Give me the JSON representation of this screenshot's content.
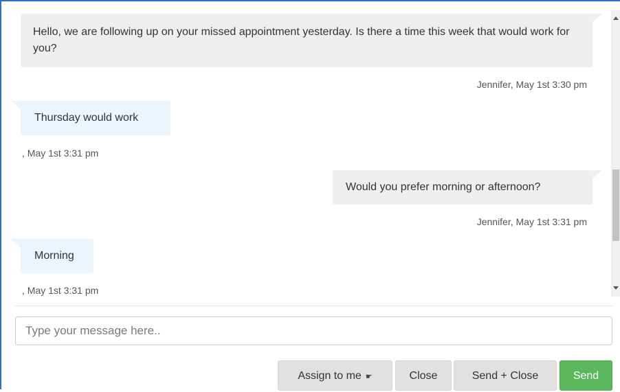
{
  "chat": {
    "messages": [
      {
        "sender": "agent",
        "text": "Hello, we are following up on your missed appointment yesterday. Is there a time this week that would work for you?",
        "meta": "Jennifer, May 1st 3:30 pm"
      },
      {
        "sender": "customer",
        "text": "Thursday would work",
        "meta": ", May 1st 3:31 pm"
      },
      {
        "sender": "agent",
        "text": "Would you prefer morning or afternoon?",
        "meta": "Jennifer, May 1st 3:31 pm"
      },
      {
        "sender": "customer",
        "text": "Morning",
        "meta": ", May 1st 3:31 pm"
      }
    ]
  },
  "composer": {
    "placeholder": "Type your message here.."
  },
  "actions": {
    "assign_label": "Assign to me",
    "close_label": "Close",
    "send_close_label": "Send + Close",
    "send_label": "Send"
  },
  "colors": {
    "agent_bubble": "#efefef",
    "customer_bubble": "#eaf5fd",
    "send_button": "#5cb85c",
    "frame_border": "#2f6fca"
  },
  "icons": {
    "assign": "pointing-hand-icon"
  }
}
